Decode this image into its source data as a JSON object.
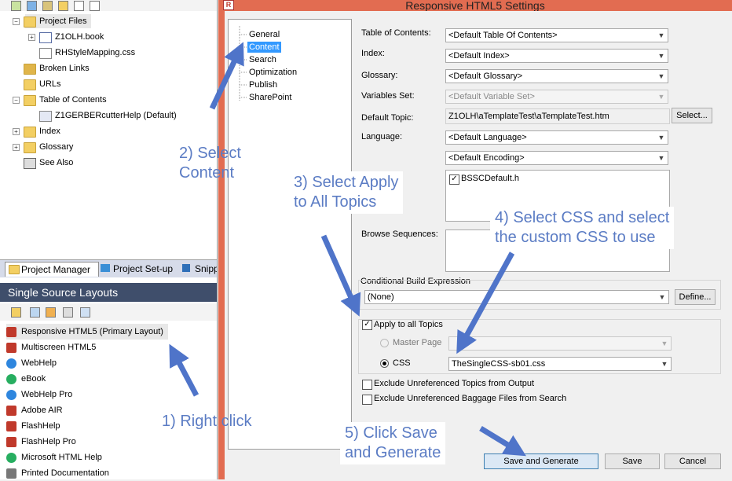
{
  "project_tree": {
    "items": [
      {
        "label": "Project Files",
        "level": 1
      },
      {
        "label": "Z1OLH.book",
        "level": 2
      },
      {
        "label": "RHStyleMapping.css",
        "level": 3
      },
      {
        "label": "Broken Links",
        "level": 1
      },
      {
        "label": "URLs",
        "level": 1
      },
      {
        "label": "Table of Contents",
        "level": 1
      },
      {
        "label": "Z1GERBERcutterHelp (Default)",
        "level": 2
      },
      {
        "label": "Index",
        "level": 1
      },
      {
        "label": "Glossary",
        "level": 1
      },
      {
        "label": "See Also",
        "level": 1
      }
    ]
  },
  "bottom_tabs": [
    "Project Manager",
    "Project Set-up",
    "Snipp"
  ],
  "ssl": {
    "header": "Single Source Layouts",
    "layouts": [
      {
        "label": "Responsive HTML5 (Primary Layout)",
        "color": "#c0392b"
      },
      {
        "label": "Multiscreen HTML5",
        "color": "#c0392b"
      },
      {
        "label": "WebHelp",
        "color": "#2e86de"
      },
      {
        "label": "eBook",
        "color": "#27ae60"
      },
      {
        "label": "WebHelp Pro",
        "color": "#2e86de"
      },
      {
        "label": "Adobe AIR",
        "color": "#c0392b"
      },
      {
        "label": "FlashHelp",
        "color": "#c0392b"
      },
      {
        "label": "FlashHelp Pro",
        "color": "#c0392b"
      },
      {
        "label": "Microsoft HTML Help",
        "color": "#27ae60"
      },
      {
        "label": "Printed Documentation",
        "color": "#555555"
      }
    ]
  },
  "dialog": {
    "title": "Responsive HTML5 Settings",
    "nav": [
      "General",
      "Content",
      "Search",
      "Optimization",
      "Publish",
      "SharePoint"
    ],
    "selected_nav": "Content",
    "fields": {
      "toc_label": "Table of Contents:",
      "toc_value": "<Default Table Of Contents>",
      "index_label": "Index:",
      "index_value": "<Default Index>",
      "glossary_label": "Glossary:",
      "glossary_value": "<Default Glossary>",
      "variables_label": "Variables Set:",
      "variables_value": "<Default Variable Set>",
      "topic_label": "Default Topic:",
      "topic_value": "Z1OLH\\aTemplateTest\\aTemplateTest.htm",
      "select_button": "Select...",
      "language_label": "Language:",
      "language_value": "<Default Language>",
      "encoding_value": "<Default Encoding>",
      "file_item": "BSSCDefault.h",
      "browse_label": "Browse Sequences:",
      "cbe_label": "Conditional Build Expression",
      "cbe_value": "(None)",
      "define_button": "Define...",
      "apply_all_label": "Apply to all Topics",
      "master_page_label": "Master Page",
      "css_label": "CSS",
      "css_value": "TheSingleCSS-sb01.css",
      "exclude_topics_label": "Exclude Unreferenced Topics from Output",
      "exclude_baggage_label": "Exclude Unreferenced Baggage Files from Search"
    },
    "buttons": {
      "save_generate": "Save and Generate",
      "save": "Save",
      "cancel": "Cancel"
    }
  },
  "annotations": {
    "step1": "1) Right click",
    "step2": "2) Select\nContent",
    "step3": "3) Select Apply\nto All Topics",
    "step4": "4) Select CSS and select\nthe custom CSS to use",
    "step5": "5) Click Save\nand Generate"
  },
  "colors": {
    "dialog_frame": "#e26c51",
    "annotation": "#5b7cc4",
    "arrow": "#4f74c9",
    "selection": "#3399ff"
  }
}
